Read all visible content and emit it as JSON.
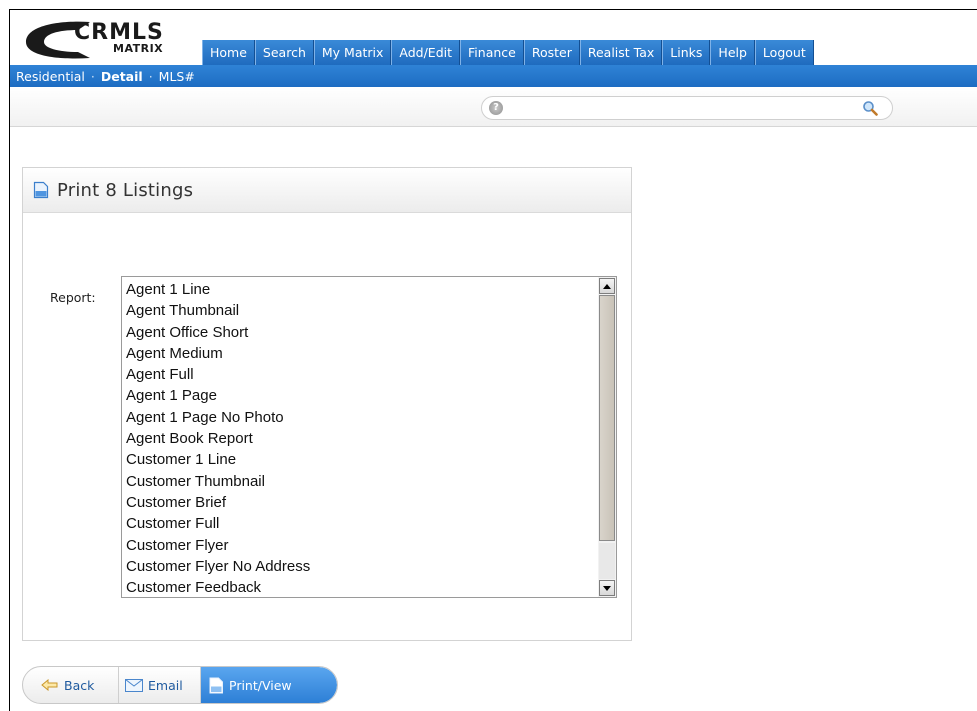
{
  "logo": {
    "brand": "CRMLS",
    "product": "MATRIX"
  },
  "topnav": {
    "items": [
      "Home",
      "Search",
      "My Matrix",
      "Add/Edit",
      "Finance",
      "Roster",
      "Realist Tax",
      "Links",
      "Help",
      "Logout"
    ]
  },
  "breadcrumb": {
    "item1": "Residential",
    "item2": "Detail",
    "item3": "MLS#",
    "separator": "·"
  },
  "search": {
    "value": "",
    "help_glyph": "?"
  },
  "panel": {
    "title": "Print 8 Listings",
    "report_label": "Report:",
    "report_options": [
      "Agent 1 Line",
      "Agent Thumbnail",
      "Agent Office Short",
      "Agent Medium",
      "Agent Full",
      "Agent 1 Page",
      "Agent 1 Page No Photo",
      "Agent Book Report",
      "Customer 1 Line",
      "Customer Thumbnail",
      "Customer Brief",
      "Customer Full",
      "Customer Flyer",
      "Customer Flyer No Address",
      "Customer Feedback"
    ]
  },
  "actions": {
    "back": "Back",
    "email": "Email",
    "print": "Print/View"
  },
  "icons": {
    "help": "help-icon",
    "search": "magnifier-icon",
    "document": "document-icon",
    "back": "back-arrow-icon",
    "email": "envelope-icon"
  },
  "colors": {
    "nav_blue": "#1f6bbf",
    "print_button": "#2d7fd6",
    "link_blue": "#1f5a9f"
  }
}
